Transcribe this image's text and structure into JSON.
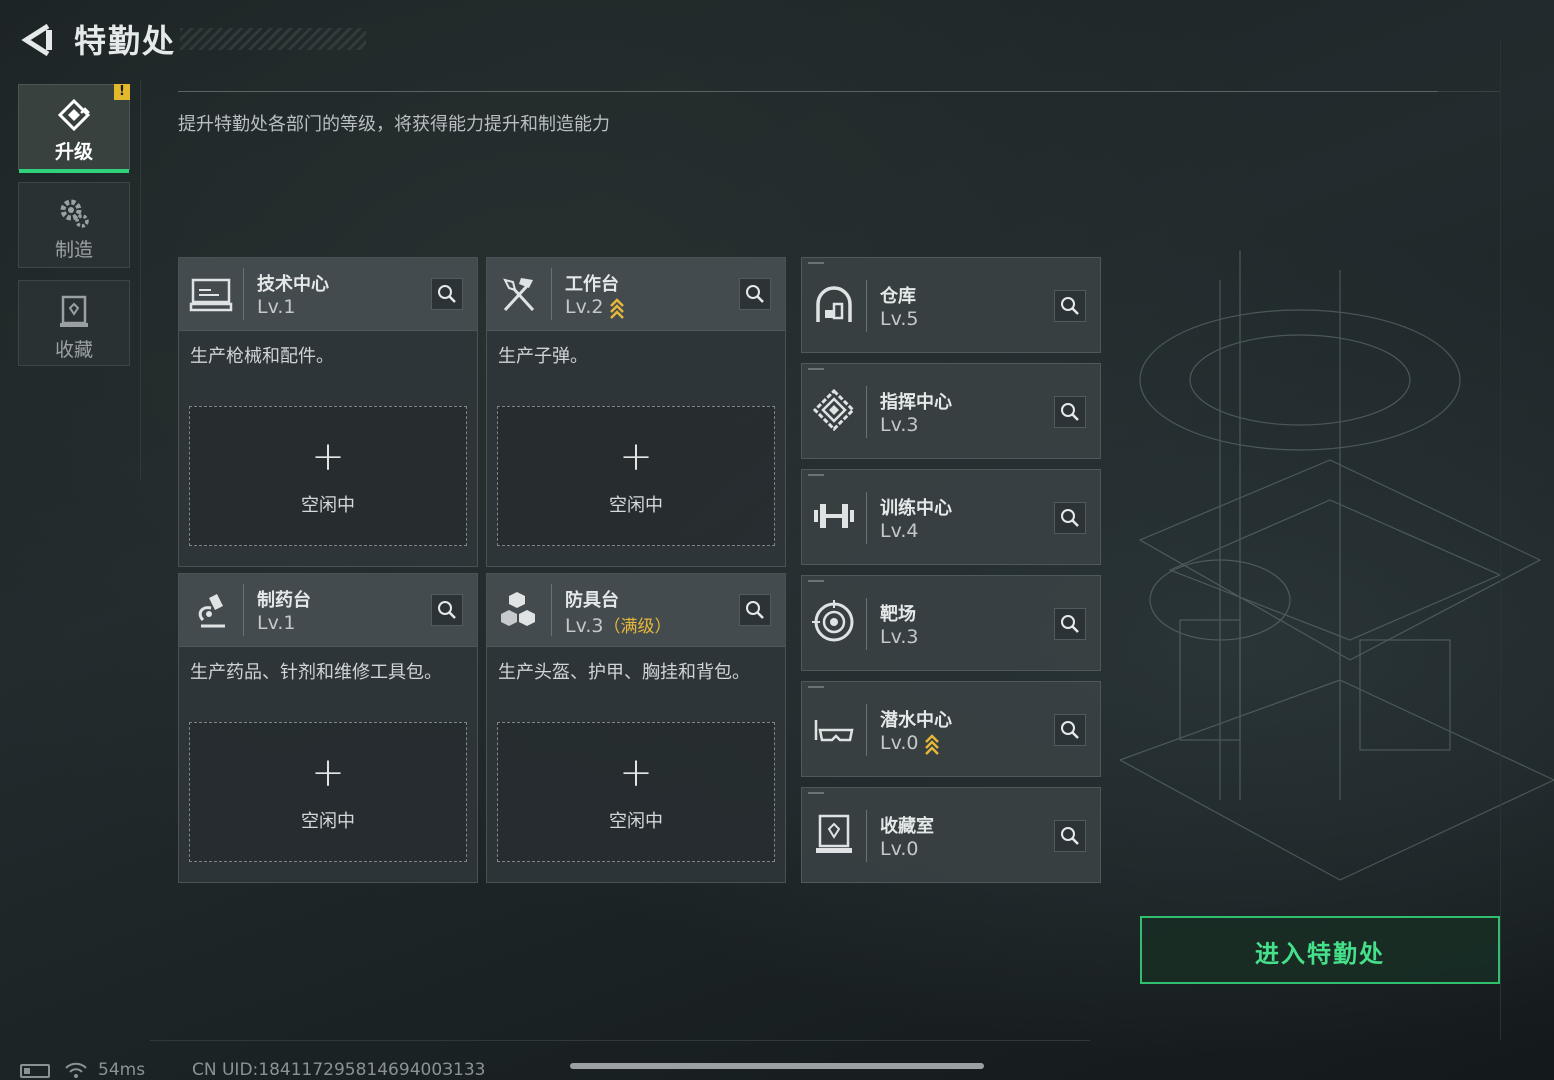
{
  "header": {
    "title": "特勤处"
  },
  "tabs": [
    {
      "label": "升级",
      "icon": "upgrade-icon",
      "active": true,
      "badge": "!"
    },
    {
      "label": "制造",
      "icon": "gear-icon",
      "active": false
    },
    {
      "label": "收藏",
      "icon": "collection-icon",
      "active": false
    }
  ],
  "subtitle": "提升特勤处各部门的等级，将获得能力提升和制造能力",
  "departments": [
    {
      "name": "技术中心",
      "level": "Lv.1",
      "desc": "生产枪械和配件。",
      "slot_plus": "+",
      "slot_label": "空闲中",
      "icon": "computer-icon"
    },
    {
      "name": "工作台",
      "level": "Lv.2",
      "desc": "生产子弹。",
      "slot_plus": "+",
      "slot_label": "空闲中",
      "icon": "tools-icon",
      "upgradable": true
    },
    {
      "name": "制药台",
      "level": "Lv.1",
      "desc": "生产药品、针剂和维修工具包。",
      "slot_plus": "+",
      "slot_label": "空闲中",
      "icon": "microscope-icon"
    },
    {
      "name": "防具台",
      "level": "Lv.3",
      "level_note": "（满级）",
      "desc": "生产头盔、护甲、胸挂和背包。",
      "slot_plus": "+",
      "slot_label": "空闲中",
      "icon": "blocks-icon"
    }
  ],
  "facilities": [
    {
      "name": "仓库",
      "level": "Lv.5",
      "icon": "warehouse-icon"
    },
    {
      "name": "指挥中心",
      "level": "Lv.3",
      "icon": "command-icon"
    },
    {
      "name": "训练中心",
      "level": "Lv.4",
      "icon": "dumbbell-icon"
    },
    {
      "name": "靶场",
      "level": "Lv.3",
      "icon": "target-icon"
    },
    {
      "name": "潜水中心",
      "level": "Lv.0",
      "icon": "diving-mask-icon",
      "upgradable": true
    },
    {
      "name": "收藏室",
      "level": "Lv.0",
      "icon": "display-case-icon"
    }
  ],
  "enter_button": "进入特勤处",
  "status": {
    "ping": "54ms",
    "uid": "CN UID:18411729581469400З133"
  },
  "colors": {
    "accent_green": "#2fd27a",
    "upgrade_gold": "#e6b83a"
  }
}
